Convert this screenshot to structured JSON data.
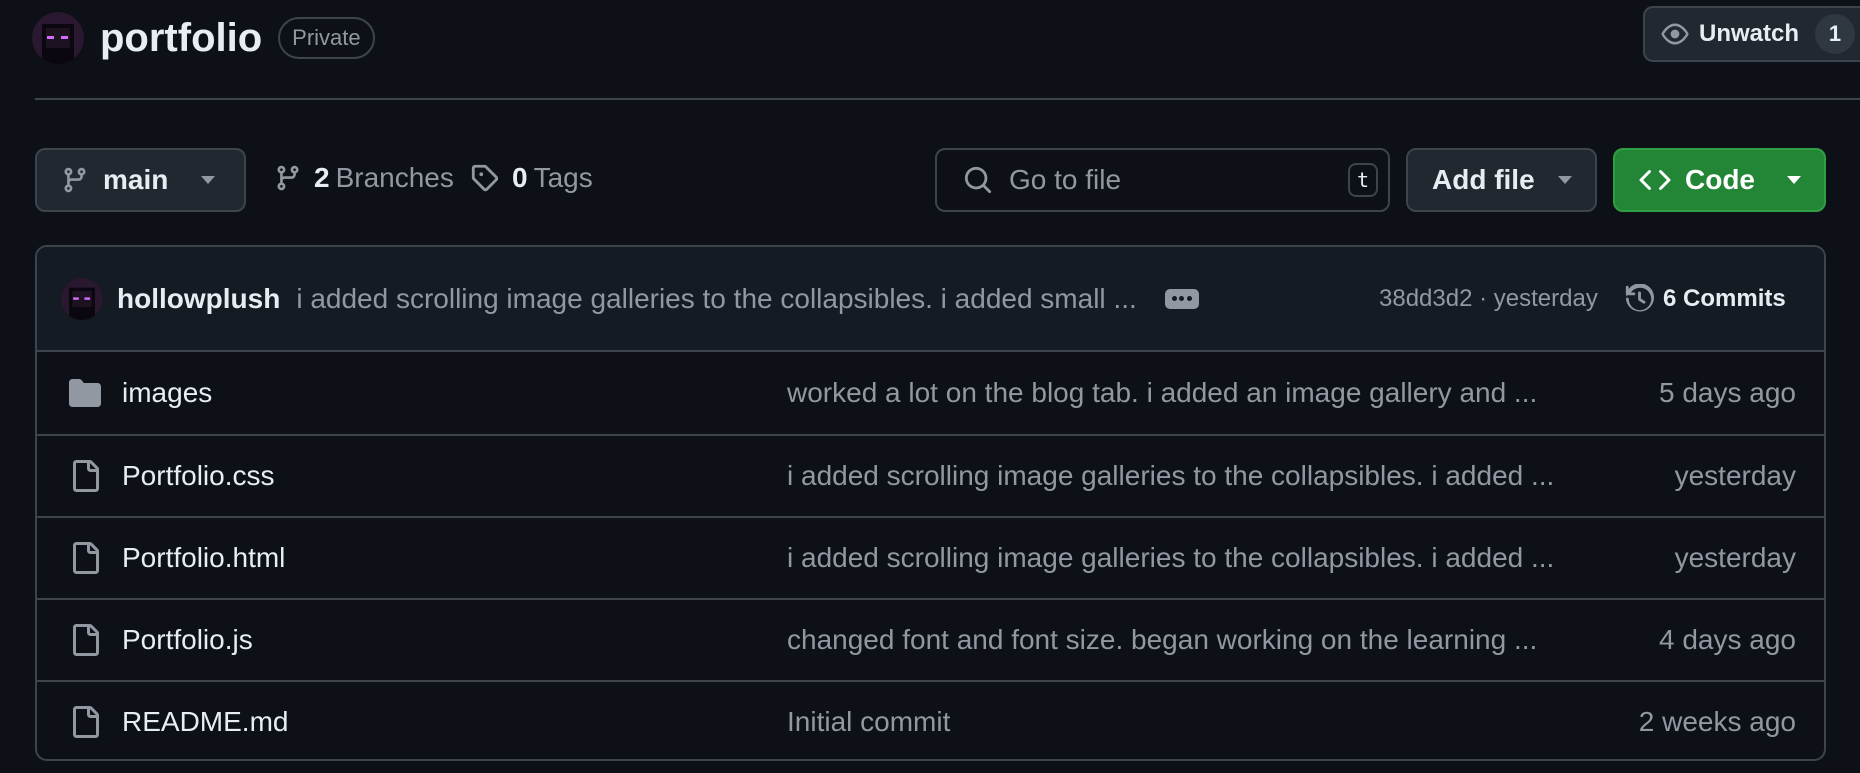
{
  "repo": {
    "name": "portfolio",
    "visibility": "Private"
  },
  "watch": {
    "label": "Unwatch",
    "count": "1"
  },
  "toolbar": {
    "branch": "main",
    "branches_count": "2",
    "branches_label": "Branches",
    "tags_count": "0",
    "tags_label": "Tags",
    "search_placeholder": "Go to file",
    "search_shortcut": "t",
    "add_file_label": "Add file",
    "code_label": "Code"
  },
  "latest_commit": {
    "author": "hollowplush",
    "message": "i added scrolling image galleries to the collapsibles. i added small ...",
    "sha_time": "38dd3d2 · yesterday",
    "commits_label": "6 Commits"
  },
  "files": [
    {
      "type": "folder",
      "icon": "folder-icon",
      "name": "images",
      "message": "worked a lot on the blog tab. i added an image gallery and ...",
      "time": "5 days ago"
    },
    {
      "type": "file",
      "icon": "file-icon",
      "name": "Portfolio.css",
      "message": "i added scrolling image galleries to the collapsibles. i added ...",
      "time": "yesterday"
    },
    {
      "type": "file",
      "icon": "file-icon",
      "name": "Portfolio.html",
      "message": "i added scrolling image galleries to the collapsibles. i added ...",
      "time": "yesterday"
    },
    {
      "type": "file",
      "icon": "file-icon",
      "name": "Portfolio.js",
      "message": "changed font and font size. began working on the learning ...",
      "time": "4 days ago"
    },
    {
      "type": "file",
      "icon": "file-icon",
      "name": "README.md",
      "message": "Initial commit",
      "time": "2 weeks ago"
    }
  ],
  "colors": {
    "background": "#0d1117",
    "border": "#3d444d",
    "code_button": "#238636",
    "muted_text": "#9198a1"
  }
}
